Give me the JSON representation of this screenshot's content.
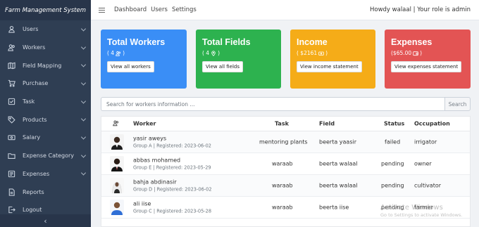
{
  "app": {
    "brand": "Farm Management System"
  },
  "sidebar": {
    "items": [
      {
        "label": "Users",
        "icon": "user-icon",
        "has_chevron": true
      },
      {
        "label": "Workers",
        "icon": "users-icon",
        "has_chevron": true
      },
      {
        "label": "Field Mapping",
        "icon": "map-icon",
        "has_chevron": true
      },
      {
        "label": "Purchase",
        "icon": "cart-icon",
        "has_chevron": true
      },
      {
        "label": "Task",
        "icon": "task-icon",
        "has_chevron": true
      },
      {
        "label": "Products",
        "icon": "tag-icon",
        "has_chevron": true
      },
      {
        "label": "Salary",
        "icon": "salary-icon",
        "has_chevron": true
      },
      {
        "label": "Expense Category",
        "icon": "folder-icon",
        "has_chevron": true
      },
      {
        "label": "Expenses",
        "icon": "expense-icon",
        "has_chevron": true
      },
      {
        "label": "Reports",
        "icon": "report-icon",
        "has_chevron": false
      },
      {
        "label": "Logout",
        "icon": "logout-icon",
        "has_chevron": false
      }
    ],
    "collapse_glyph": "‹"
  },
  "topbar": {
    "links": [
      "Dashboard",
      "Users",
      "Settings"
    ],
    "greeting": "Howdy walaal | Your role is admin"
  },
  "cards": [
    {
      "title": "Total Workers",
      "sub_text": "( 4",
      "sub_close": ")",
      "icon": "users-icon",
      "button": "View all workers",
      "color": "#3a8ef6"
    },
    {
      "title": "Total Fields",
      "sub_text": "( 4",
      "sub_close": ")",
      "icon": "pin-icon",
      "button": "View all fields",
      "color": "#2db24f"
    },
    {
      "title": "Income",
      "sub_text": "( $2161",
      "sub_close": ")",
      "icon": "money-icon",
      "button": "View income statement",
      "color": "#f5ac18"
    },
    {
      "title": "Expenses",
      "sub_text": "($65.00",
      "sub_close": ")",
      "icon": "wallet-icon",
      "button": "View expenses statement",
      "color": "#e35454"
    }
  ],
  "search": {
    "placeholder": "Search for workers information ...",
    "button": "Search"
  },
  "table": {
    "headers": {
      "icon": "users-icon",
      "worker": "Worker",
      "task": "Task",
      "field": "Field",
      "status": "Status",
      "occupation": "Occupation"
    },
    "rows": [
      {
        "name": "yasir aweys",
        "meta": "Group A | Registered: 2023-06-02",
        "task": "mentoring plants",
        "field": "beerta yaasir",
        "status": "failed",
        "occupation": "irrigator",
        "avatar": "man-dark"
      },
      {
        "name": "abbas mohamed",
        "meta": "Group E | Registered: 2023-05-29",
        "task": "waraab",
        "field": "beerta walaal",
        "status": "pending",
        "occupation": "owner",
        "avatar": "man-suit"
      },
      {
        "name": "bahja abdinasir",
        "meta": "Group D | Registered: 2023-06-02",
        "task": "waraab",
        "field": "beerta walaal",
        "status": "pending",
        "occupation": "cultivator",
        "avatar": "woman-hijab"
      },
      {
        "name": "ali iise",
        "meta": "Group C | Registered: 2023-05-28",
        "task": "waraab",
        "field": "beerta iise",
        "status": "pending",
        "occupation": "farmer",
        "avatar": "man-blue"
      }
    ]
  },
  "watermark": {
    "line1": "Activate Windows",
    "line2": "Go to Settings to activate Windows."
  }
}
